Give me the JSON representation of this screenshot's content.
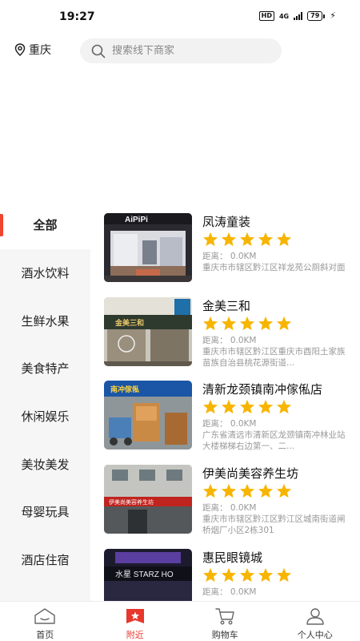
{
  "status_bar": {
    "time": "19:27",
    "hd": "HD",
    "network": "4G",
    "battery": "79"
  },
  "header": {
    "location": "重庆",
    "search_placeholder": "搜索线下商家"
  },
  "sidebar": {
    "items": [
      {
        "label": "全部",
        "active": true
      },
      {
        "label": "酒水饮料",
        "active": false
      },
      {
        "label": "生鲜水果",
        "active": false
      },
      {
        "label": "美食特产",
        "active": false
      },
      {
        "label": "休闲娱乐",
        "active": false
      },
      {
        "label": "美妆美发",
        "active": false
      },
      {
        "label": "母婴玩具",
        "active": false
      },
      {
        "label": "酒店住宿",
        "active": false
      }
    ]
  },
  "stores": [
    {
      "name": "凤涛童装",
      "rating": 5,
      "distance": "距离： 0.0KM",
      "address": "重庆市市辖区黔江区祥龙苑公厕斜对面",
      "photo_sign": "AiPiPi"
    },
    {
      "name": "金美三和",
      "rating": 5,
      "distance": "距离： 0.0KM",
      "address": "重庆市市辖区黔江区重庆市酉阳土家族苗族自治县桃花源街道...",
      "photo_sign": "金美三和"
    },
    {
      "name": "清新龙颈镇南冲傢俬店",
      "rating": 5,
      "distance": "距离： 0.0KM",
      "address": "广东省清远市清新区龙颈镇南冲林业站大楼梯梯右边第一、二...",
      "photo_sign": "南冲傢俬"
    },
    {
      "name": "伊美尚美容养生坊",
      "rating": 5,
      "distance": "距离： 0.0KM",
      "address": "重庆市市辖区黔江区黔江区城南街道闸桥烟厂小区2栋301",
      "photo_sign": "伊美尚美容养生坊"
    },
    {
      "name": "惠民眼镜城",
      "rating": 5,
      "distance": "距离： 0.0KM",
      "address": "",
      "photo_sign": "水星 STARZ HO"
    }
  ],
  "bottom_nav": [
    {
      "label": "首页",
      "icon": "home-icon",
      "active": false
    },
    {
      "label": "附近",
      "icon": "nearby-icon",
      "active": true
    },
    {
      "label": "购物车",
      "icon": "cart-icon",
      "active": false
    },
    {
      "label": "个人中心",
      "icon": "user-icon",
      "active": false
    }
  ],
  "colors": {
    "accent": "#e8372c",
    "star": "#f7b500",
    "sidebar_bg": "#f6f6f6",
    "search_bg": "#f2f2f2"
  }
}
